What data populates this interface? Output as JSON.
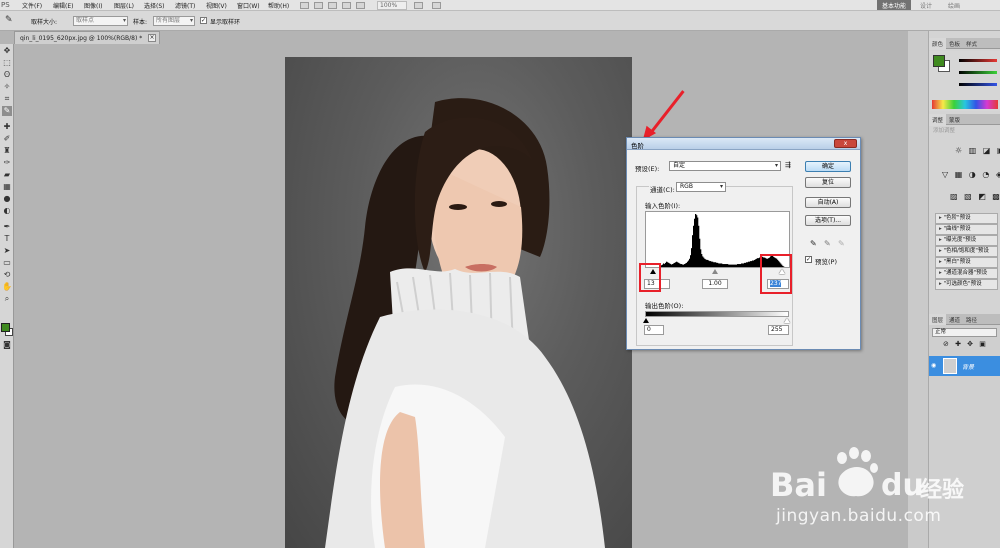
{
  "app": {
    "logo": "PS"
  },
  "menu": {
    "items": [
      "文件(F)",
      "编辑(E)",
      "图像(I)",
      "图层(L)",
      "选择(S)",
      "滤镜(T)",
      "视图(V)",
      "窗口(W)",
      "帮助(H)"
    ],
    "zoom": "100%"
  },
  "workspace": {
    "active": "基本功能",
    "others": [
      "设计",
      "绘画"
    ]
  },
  "options": {
    "sample_size_label": "取样大小:",
    "sample_size_value": "取样点",
    "sample_label": "样本:",
    "sample_value": "所有图层",
    "show_ring_label": "显示取样环",
    "show_ring_checked": true
  },
  "document": {
    "tab_title": "qin_li_0195_620px.jpg @ 100%(RGB/8) *",
    "close": "×"
  },
  "dialog": {
    "title": "色阶",
    "close": "x",
    "preset_label": "预设(E):",
    "preset_value": "自定",
    "channel_label": "通道(C):",
    "channel_value": "RGB",
    "input_label": "输入色阶(I):",
    "input_black": "13",
    "input_gamma": "1.00",
    "input_white": "237",
    "output_label": "输出色阶(O):",
    "output_black": "0",
    "output_white": "255",
    "buttons": {
      "ok": "确定",
      "reset": "复位",
      "auto": "自动(A)",
      "options": "选项(T)..."
    },
    "preview_label": "预览(P)",
    "preview_checked": true
  },
  "panels": {
    "color_tabs": [
      "颜色",
      "色板",
      "样式"
    ],
    "adjust_tabs": [
      "调整",
      "蒙版"
    ],
    "adjust_hint": "添加调整",
    "presets": [
      "\"色阶\"预设",
      "\"曲线\"预设",
      "\"曝光度\"预设",
      "\"色相/饱和度\"预设",
      "\"黑白\"预设",
      "\"通道混合器\"预设",
      "\"可选颜色\"预设"
    ],
    "layer_tabs": [
      "图层",
      "通道",
      "路径"
    ],
    "blend_mode": "正常",
    "layer_name": "背景"
  },
  "watermark": {
    "brand": "Bai",
    "brand2": "du",
    "cn": "经验",
    "url": "jingyan.baidu.com"
  },
  "colors": {
    "accent_red": "#e8202a",
    "foreground": "#3f8a1f",
    "layer_selected": "#3b8ee0"
  },
  "histogram": {
    "bins": [
      0,
      0,
      0,
      0,
      0,
      0,
      0,
      0,
      0,
      0,
      0,
      0,
      0,
      1,
      2,
      3,
      4,
      6,
      5,
      7,
      9,
      8,
      7,
      6,
      5,
      4,
      5,
      6,
      7,
      8,
      9,
      8,
      7,
      6,
      5,
      5,
      4,
      4,
      5,
      6,
      7,
      9,
      11,
      14,
      20,
      32,
      54,
      70,
      82,
      90,
      88,
      84,
      70,
      48,
      30,
      22,
      18,
      16,
      14,
      13,
      12,
      12,
      11,
      10,
      10,
      9,
      9,
      8,
      8,
      8,
      7,
      7,
      6,
      6,
      6,
      6,
      5,
      5,
      5,
      5,
      5,
      5,
      4,
      4,
      4,
      4,
      4,
      4,
      4,
      4,
      4,
      5,
      5,
      5,
      5,
      6,
      6,
      6,
      7,
      7,
      8,
      8,
      9,
      9,
      10,
      10,
      11,
      11,
      12,
      13,
      14,
      15,
      15,
      16,
      18,
      18,
      17,
      16,
      16,
      15,
      14,
      14,
      15,
      16,
      18,
      20,
      19,
      17,
      16,
      15,
      14,
      12,
      10,
      8,
      6,
      4,
      2,
      1,
      0,
      0,
      0,
      0,
      0
    ]
  }
}
